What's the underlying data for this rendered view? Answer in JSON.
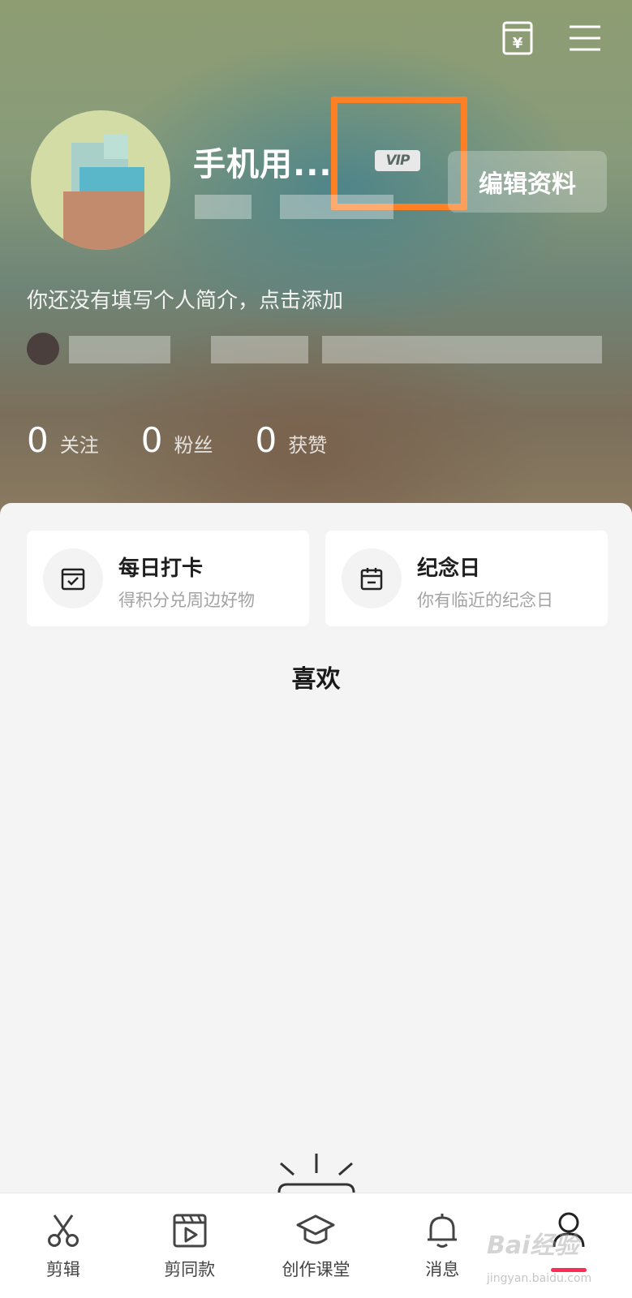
{
  "header": {
    "username": "手机用...",
    "vip_label": "VIP",
    "edit_profile_label": "编辑资料",
    "bio_placeholder": "你还没有填写个人简介，点击添加"
  },
  "stats": [
    {
      "value": "0",
      "label": "关注"
    },
    {
      "value": "0",
      "label": "粉丝"
    },
    {
      "value": "0",
      "label": "获赞"
    }
  ],
  "cards": [
    {
      "title": "每日打卡",
      "subtitle": "得积分兑周边好物",
      "icon": "checkin-calendar-icon"
    },
    {
      "title": "纪念日",
      "subtitle": "你有临近的纪念日",
      "icon": "calendar-icon"
    }
  ],
  "content": {
    "likes_tab_label": "喜欢"
  },
  "bottom_nav": {
    "active_index": 4,
    "items": [
      {
        "label": "剪辑",
        "icon": "scissors-icon"
      },
      {
        "label": "剪同款",
        "icon": "template-video-icon"
      },
      {
        "label": "创作课堂",
        "icon": "graduation-cap-icon"
      },
      {
        "label": "消息",
        "icon": "bell-icon"
      },
      {
        "label": "",
        "icon": "profile-icon"
      }
    ]
  },
  "watermark": {
    "logo": "Bai经验",
    "url": "jingyan.baidu.com"
  },
  "colors": {
    "highlight": "#ff7f24",
    "active_indicator": "#ff2d55",
    "card_bg": "#ffffff",
    "page_bg": "#f4f4f4"
  }
}
